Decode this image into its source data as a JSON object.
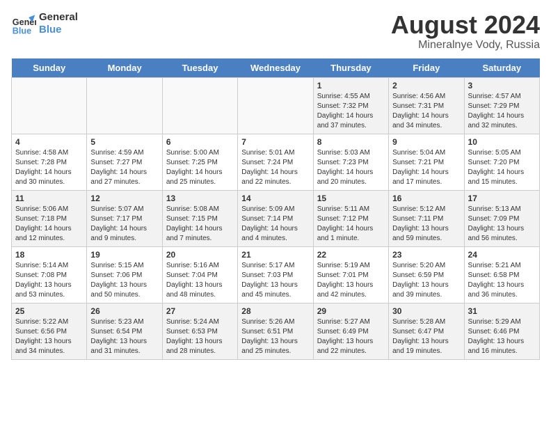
{
  "header": {
    "logo_line1": "General",
    "logo_line2": "Blue",
    "month": "August 2024",
    "location": "Mineralnye Vody, Russia"
  },
  "weekdays": [
    "Sunday",
    "Monday",
    "Tuesday",
    "Wednesday",
    "Thursday",
    "Friday",
    "Saturday"
  ],
  "weeks": [
    [
      {
        "day": "",
        "info": "",
        "empty": true
      },
      {
        "day": "",
        "info": "",
        "empty": true
      },
      {
        "day": "",
        "info": "",
        "empty": true
      },
      {
        "day": "",
        "info": "",
        "empty": true
      },
      {
        "day": "1",
        "info": "Sunrise: 4:55 AM\nSunset: 7:32 PM\nDaylight: 14 hours\nand 37 minutes."
      },
      {
        "day": "2",
        "info": "Sunrise: 4:56 AM\nSunset: 7:31 PM\nDaylight: 14 hours\nand 34 minutes."
      },
      {
        "day": "3",
        "info": "Sunrise: 4:57 AM\nSunset: 7:29 PM\nDaylight: 14 hours\nand 32 minutes."
      }
    ],
    [
      {
        "day": "4",
        "info": "Sunrise: 4:58 AM\nSunset: 7:28 PM\nDaylight: 14 hours\nand 30 minutes."
      },
      {
        "day": "5",
        "info": "Sunrise: 4:59 AM\nSunset: 7:27 PM\nDaylight: 14 hours\nand 27 minutes."
      },
      {
        "day": "6",
        "info": "Sunrise: 5:00 AM\nSunset: 7:25 PM\nDaylight: 14 hours\nand 25 minutes."
      },
      {
        "day": "7",
        "info": "Sunrise: 5:01 AM\nSunset: 7:24 PM\nDaylight: 14 hours\nand 22 minutes."
      },
      {
        "day": "8",
        "info": "Sunrise: 5:03 AM\nSunset: 7:23 PM\nDaylight: 14 hours\nand 20 minutes."
      },
      {
        "day": "9",
        "info": "Sunrise: 5:04 AM\nSunset: 7:21 PM\nDaylight: 14 hours\nand 17 minutes."
      },
      {
        "day": "10",
        "info": "Sunrise: 5:05 AM\nSunset: 7:20 PM\nDaylight: 14 hours\nand 15 minutes."
      }
    ],
    [
      {
        "day": "11",
        "info": "Sunrise: 5:06 AM\nSunset: 7:18 PM\nDaylight: 14 hours\nand 12 minutes."
      },
      {
        "day": "12",
        "info": "Sunrise: 5:07 AM\nSunset: 7:17 PM\nDaylight: 14 hours\nand 9 minutes."
      },
      {
        "day": "13",
        "info": "Sunrise: 5:08 AM\nSunset: 7:15 PM\nDaylight: 14 hours\nand 7 minutes."
      },
      {
        "day": "14",
        "info": "Sunrise: 5:09 AM\nSunset: 7:14 PM\nDaylight: 14 hours\nand 4 minutes."
      },
      {
        "day": "15",
        "info": "Sunrise: 5:11 AM\nSunset: 7:12 PM\nDaylight: 14 hours\nand 1 minute."
      },
      {
        "day": "16",
        "info": "Sunrise: 5:12 AM\nSunset: 7:11 PM\nDaylight: 13 hours\nand 59 minutes."
      },
      {
        "day": "17",
        "info": "Sunrise: 5:13 AM\nSunset: 7:09 PM\nDaylight: 13 hours\nand 56 minutes."
      }
    ],
    [
      {
        "day": "18",
        "info": "Sunrise: 5:14 AM\nSunset: 7:08 PM\nDaylight: 13 hours\nand 53 minutes."
      },
      {
        "day": "19",
        "info": "Sunrise: 5:15 AM\nSunset: 7:06 PM\nDaylight: 13 hours\nand 50 minutes."
      },
      {
        "day": "20",
        "info": "Sunrise: 5:16 AM\nSunset: 7:04 PM\nDaylight: 13 hours\nand 48 minutes."
      },
      {
        "day": "21",
        "info": "Sunrise: 5:17 AM\nSunset: 7:03 PM\nDaylight: 13 hours\nand 45 minutes."
      },
      {
        "day": "22",
        "info": "Sunrise: 5:19 AM\nSunset: 7:01 PM\nDaylight: 13 hours\nand 42 minutes."
      },
      {
        "day": "23",
        "info": "Sunrise: 5:20 AM\nSunset: 6:59 PM\nDaylight: 13 hours\nand 39 minutes."
      },
      {
        "day": "24",
        "info": "Sunrise: 5:21 AM\nSunset: 6:58 PM\nDaylight: 13 hours\nand 36 minutes."
      }
    ],
    [
      {
        "day": "25",
        "info": "Sunrise: 5:22 AM\nSunset: 6:56 PM\nDaylight: 13 hours\nand 34 minutes."
      },
      {
        "day": "26",
        "info": "Sunrise: 5:23 AM\nSunset: 6:54 PM\nDaylight: 13 hours\nand 31 minutes."
      },
      {
        "day": "27",
        "info": "Sunrise: 5:24 AM\nSunset: 6:53 PM\nDaylight: 13 hours\nand 28 minutes."
      },
      {
        "day": "28",
        "info": "Sunrise: 5:26 AM\nSunset: 6:51 PM\nDaylight: 13 hours\nand 25 minutes."
      },
      {
        "day": "29",
        "info": "Sunrise: 5:27 AM\nSunset: 6:49 PM\nDaylight: 13 hours\nand 22 minutes."
      },
      {
        "day": "30",
        "info": "Sunrise: 5:28 AM\nSunset: 6:47 PM\nDaylight: 13 hours\nand 19 minutes."
      },
      {
        "day": "31",
        "info": "Sunrise: 5:29 AM\nSunset: 6:46 PM\nDaylight: 13 hours\nand 16 minutes."
      }
    ]
  ]
}
